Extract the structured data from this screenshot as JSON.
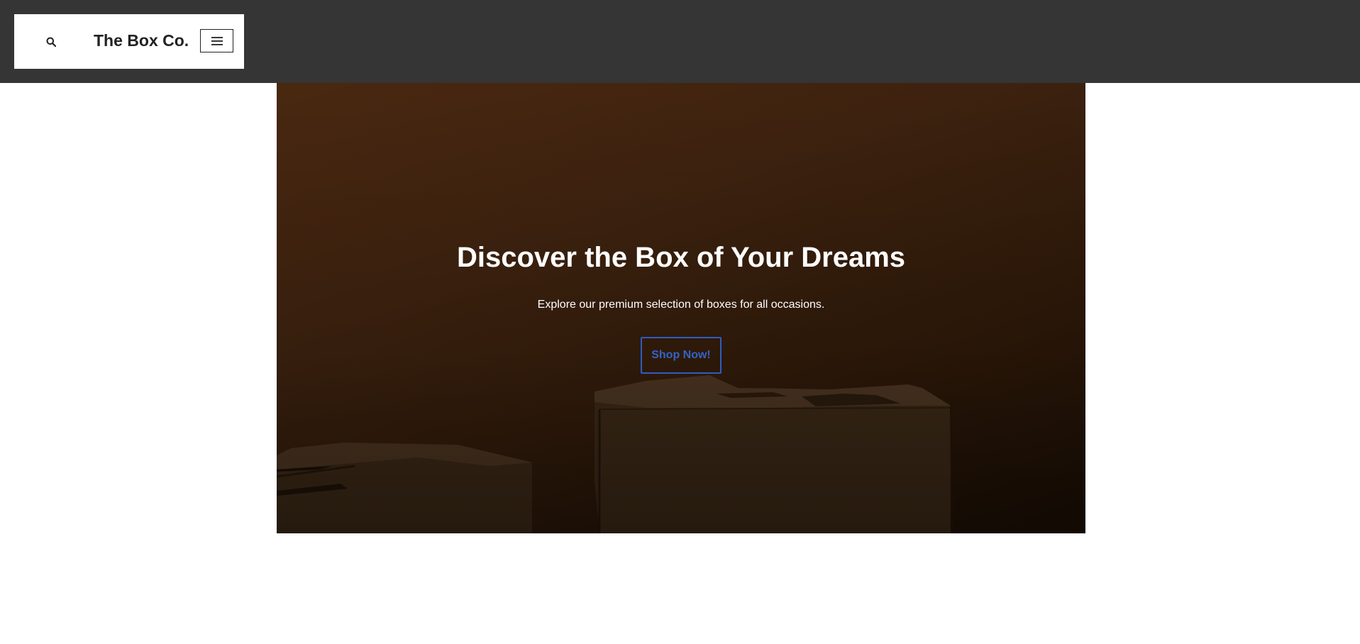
{
  "header": {
    "brand": "The Box Co.",
    "search_icon": "search-icon",
    "menu_icon": "hamburger-menu-icon",
    "background": "#353535"
  },
  "hero": {
    "title": "Discover the Box of Your Dreams",
    "subtitle": "Explore our premium selection of boxes for all occasions.",
    "cta_label": "Shop Now!",
    "cta_color": "#2f5cbf"
  }
}
